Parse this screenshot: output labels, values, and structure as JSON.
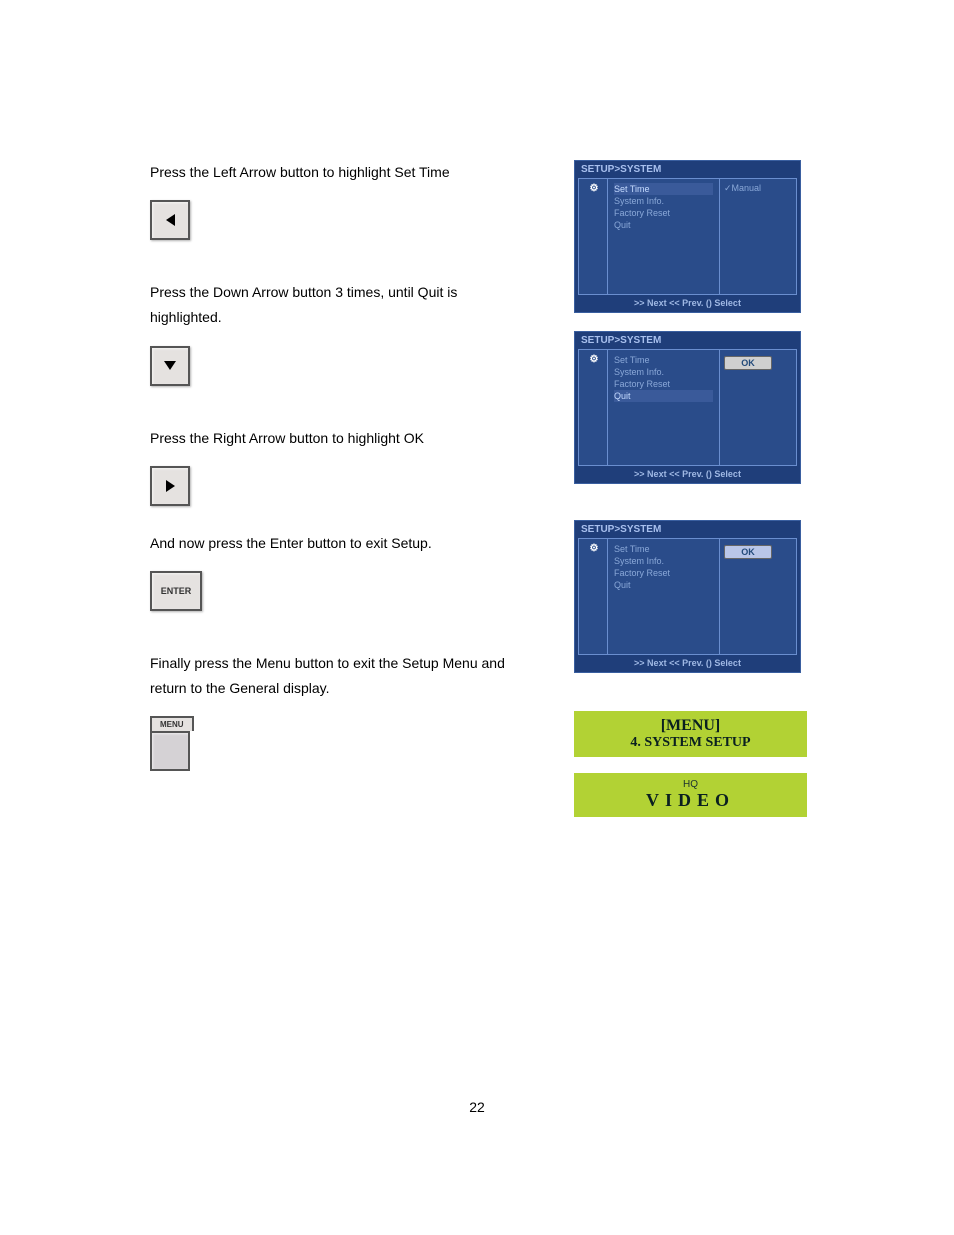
{
  "steps": {
    "s1": {
      "text": "Press the Left Arrow button to highlight Set Time"
    },
    "s2": {
      "text": "Press the Down Arrow button 3 times, until Quit is highlighted."
    },
    "s3": {
      "text": "Press the Right Arrow button to highlight OK"
    },
    "s4": {
      "text": "And now press the Enter button to exit Setup."
    },
    "s5": {
      "text": "Finally press the Menu button to exit the Setup Menu and return to the General display."
    }
  },
  "buttons": {
    "enter_label": "ENTER",
    "menu_label": "MENU"
  },
  "osd": {
    "breadcrumb": "SETUP>SYSTEM",
    "items": {
      "set_time": "Set Time",
      "system_info": "System Info.",
      "factory_reset": "Factory Reset",
      "quit": "Quit"
    },
    "right_manual": "✓Manual",
    "ok_label": "OK",
    "footer": ">> Next  << Prev.  () Select"
  },
  "green1": {
    "line1": "[MENU]",
    "line2": "4. SYSTEM SETUP"
  },
  "green2": {
    "hq": "HQ",
    "video": "VIDEO"
  },
  "page_number": "22"
}
